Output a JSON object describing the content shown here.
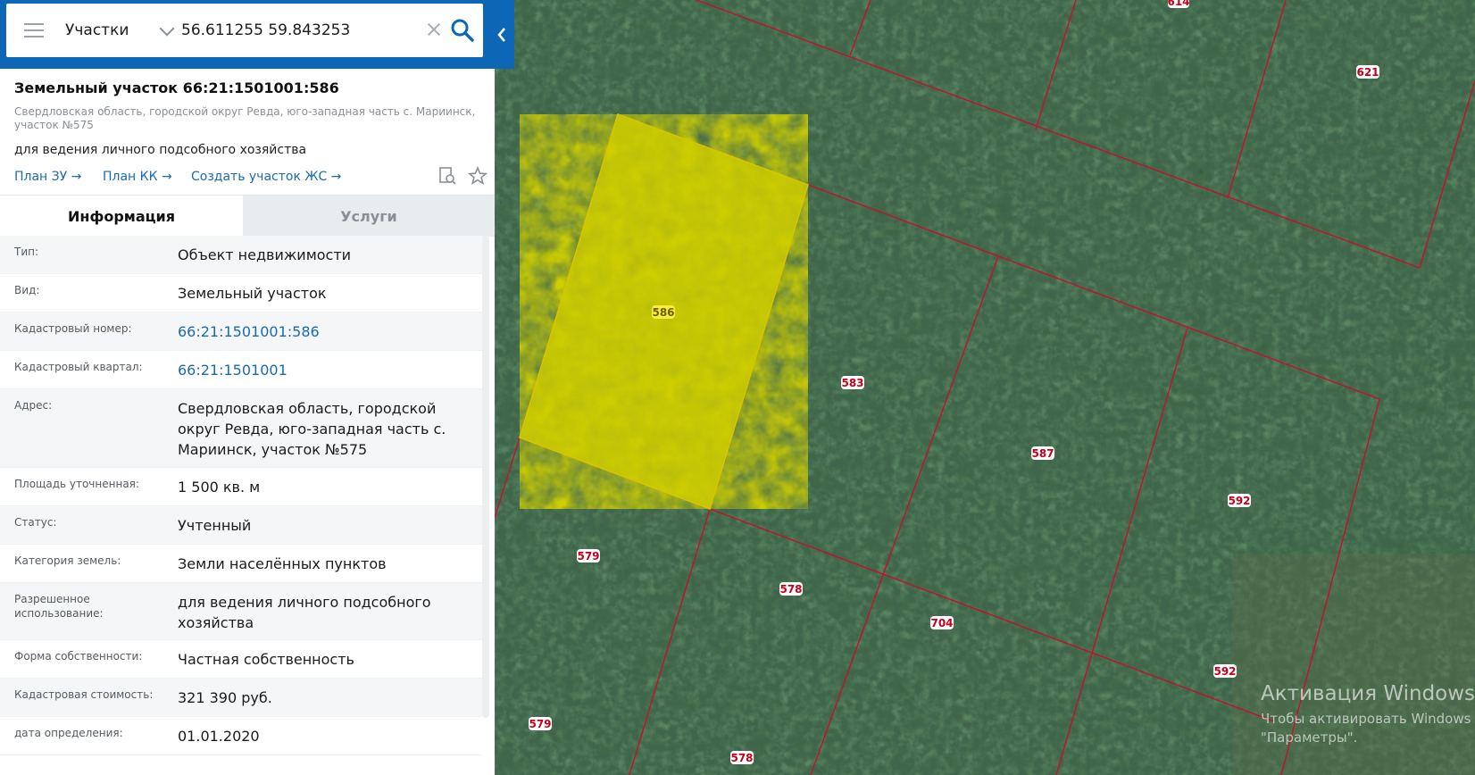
{
  "search": {
    "type_label": "Участки",
    "coordinates": "56.611255 59.843253"
  },
  "parcel": {
    "title": "Земельный участок 66:21:1501001:586",
    "address": "Свердловская область, городской округ Ревда, юго-западная часть с. Мариинск, участок №575",
    "use": "для ведения личного подсобного хозяйства",
    "links": [
      "План ЗУ →",
      "План КК →",
      "Создать участок ЖС →"
    ]
  },
  "tabs": [
    "Информация",
    "Услуги"
  ],
  "info_rows": [
    {
      "key": "Тип:",
      "value": "Объект недвижимости"
    },
    {
      "key": "Вид:",
      "value": "Земельный участок"
    },
    {
      "key": "Кадастровый номер:",
      "value": "66:21:1501001:586"
    },
    {
      "key": "Кадастровый квартал:",
      "value": "66:21:1501001"
    },
    {
      "key": "Адрес:",
      "value": "Свердловская область, городской округ Ревда, юго-западная часть с. Мариинск, участок №575"
    },
    {
      "key": "Площадь уточненная:",
      "value": "1 500 кв. м"
    },
    {
      "key": "Статус:",
      "value": "Учтенный"
    },
    {
      "key": "Категория земель:",
      "value": "Земли населённых пунктов"
    },
    {
      "key": "Разрешенное использование:",
      "value": "для ведения личного подсобного хозяйства"
    },
    {
      "key": "Форма собственности:",
      "value": "Частная собственность"
    },
    {
      "key": "Кадастровая стоимость:",
      "value": "321 390 руб."
    },
    {
      "key": "дата определения:",
      "value": "01.01.2020"
    }
  ],
  "map": {
    "plot_labels": [
      "614",
      "621",
      "586",
      "583",
      "587",
      "592",
      "579",
      "578",
      "704",
      "592",
      "579",
      "578"
    ],
    "selected_plot": "586",
    "boundary_color": "#c8102e",
    "selected_fill": "#c9c800"
  },
  "watermark": {
    "line1": "Активация Windows",
    "line2": "Чтобы активировать Windows",
    "line3": "\"Параметры\"."
  },
  "icons": [
    "menu-icon",
    "chevron-down-icon",
    "clear-icon",
    "search-icon",
    "collapse-arrow-icon",
    "document-search-icon",
    "star-icon",
    "arrow-right-icon"
  ]
}
